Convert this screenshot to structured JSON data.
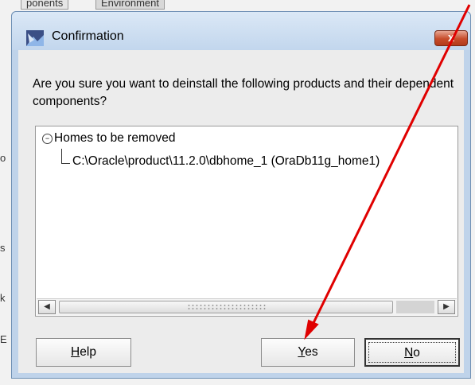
{
  "background": {
    "tabs": [
      "ponents",
      "Environment"
    ],
    "edge_glyphs": [
      "o",
      "s",
      "k",
      "E"
    ]
  },
  "dialog": {
    "title": "Confirmation",
    "close_label": "x",
    "message": "Are you sure you want to deinstall the following products and their dependent components?",
    "tree": {
      "root_label": "Homes to be removed",
      "expand_glyph": "−",
      "child_label": "C:\\Oracle\\product\\11.2.0\\dbhome_1 (OraDb11g_home1)"
    },
    "scroll": {
      "left_glyph": "◀",
      "right_glyph": "▶"
    },
    "buttons": {
      "help": {
        "mnemonic": "H",
        "rest": "elp"
      },
      "yes": {
        "mnemonic": "Y",
        "rest": "es"
      },
      "no": {
        "mnemonic": "N",
        "rest": "o"
      }
    }
  },
  "annotation": {
    "arrow_color": "#e00000",
    "arrow_target": "yes-button"
  },
  "colors": {
    "title_bar": "#c2d6ed",
    "close_button": "#c74c2a",
    "client_bg": "#ececec"
  }
}
